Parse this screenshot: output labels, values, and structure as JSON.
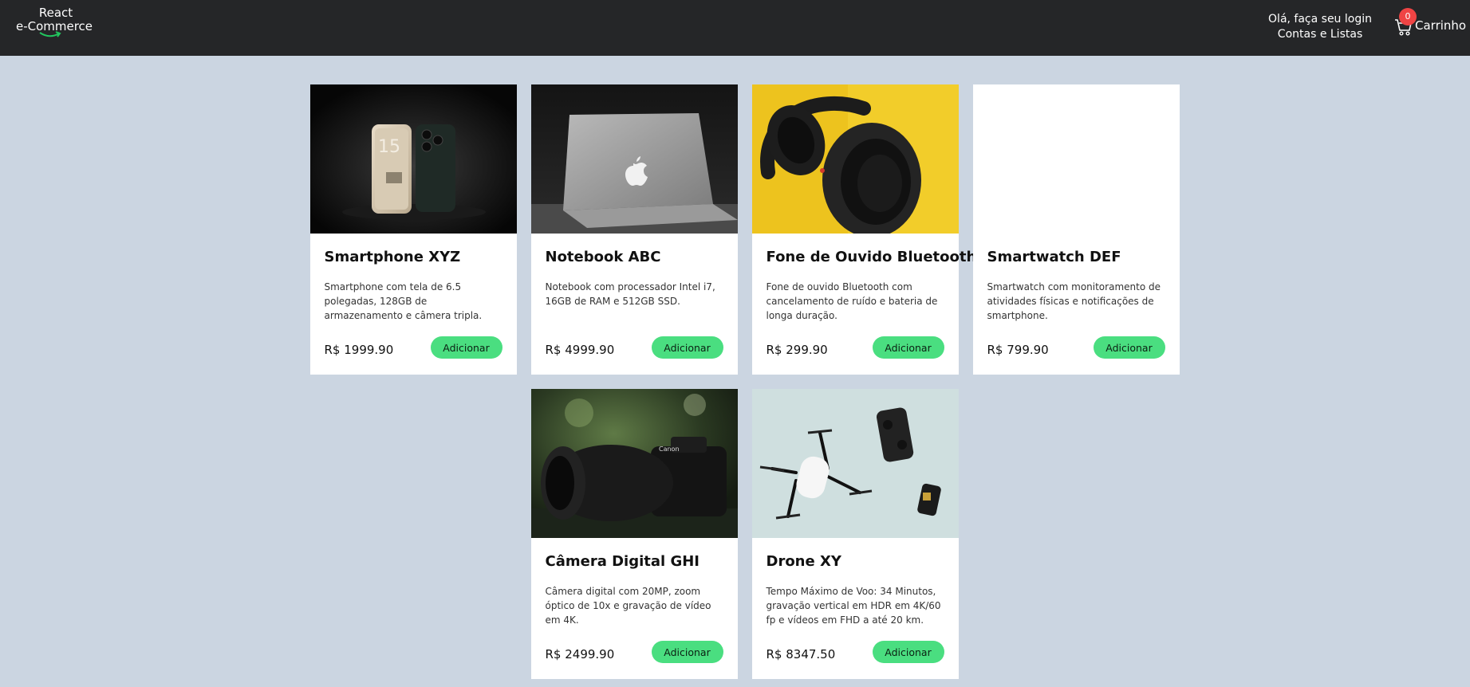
{
  "header": {
    "logo_line1": "React",
    "logo_line2": "e-Commerce",
    "greeting": "Olá, faça seu login",
    "accounts": "Contas e Listas",
    "cart_count": "0",
    "cart_label": "Carrinho"
  },
  "colors": {
    "header_bg": "#252628",
    "page_bg": "#cbd5e1",
    "button": "#4ade80",
    "badge": "#ef4444"
  },
  "products": [
    {
      "title": "Smartphone XYZ",
      "description": "Smartphone com tela de 6.5 polegadas, 128GB de armazenamento e câmera tripla.",
      "price": "R$ 1999.90",
      "button": "Adicionar",
      "image": "smartphone-photo"
    },
    {
      "title": "Notebook ABC",
      "description": "Notebook com processador Intel i7, 16GB de RAM e 512GB SSD.",
      "price": "R$ 4999.90",
      "button": "Adicionar",
      "image": "notebook-photo"
    },
    {
      "title": "Fone de Ouvido Bluetooth",
      "description": "Fone de ouvido Bluetooth com cancelamento de ruído e bateria de longa duração.",
      "price": "R$ 299.90",
      "button": "Adicionar",
      "image": "headphones-photo"
    },
    {
      "title": "Smartwatch DEF",
      "description": "Smartwatch com monitoramento de atividades físicas e notificações de smartphone.",
      "price": "R$ 799.90",
      "button": "Adicionar",
      "image": "blank-image"
    },
    {
      "title": "Câmera Digital GHI",
      "description": "Câmera digital com 20MP, zoom óptico de 10x e gravação de vídeo em 4K.",
      "price": "R$ 2499.90",
      "button": "Adicionar",
      "image": "camera-photo"
    },
    {
      "title": "Drone XY",
      "description": "Tempo Máximo de Voo: 34 Minutos, gravação vertical em HDR em 4K/60 fp e vídeos em FHD a até 20 km.",
      "price": "R$ 8347.50",
      "button": "Adicionar",
      "image": "drone-photo"
    }
  ]
}
